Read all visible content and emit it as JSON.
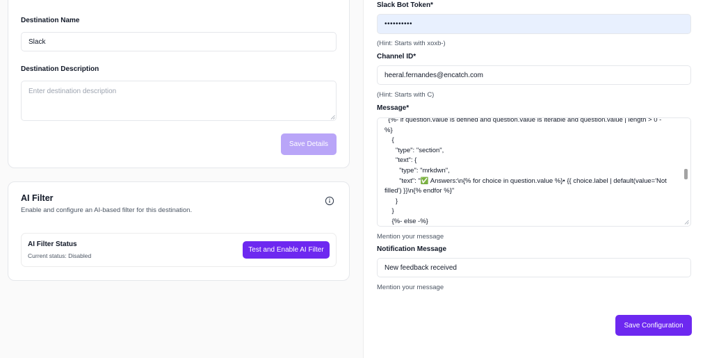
{
  "left": {
    "destination_name": {
      "label": "Destination Name",
      "value": "Slack"
    },
    "destination_description": {
      "label": "Destination Description",
      "placeholder": "Enter destination description"
    },
    "save_details_label": "Save Details",
    "ai_filter": {
      "title": "AI Filter",
      "subtitle": "Enable and configure an AI-based filter for this destination.",
      "info_icon": "info-icon",
      "status_title": "AI Filter Status",
      "status_text": "Current status: Disabled",
      "button_label": "Test and Enable AI Filter"
    }
  },
  "right": {
    "bot_token": {
      "label": "Slack Bot Token*",
      "value": "••••••••••",
      "hint": "(Hint: Starts with xoxb-)"
    },
    "channel_id": {
      "label": "Channel ID*",
      "value": "heeral.fernandes@encatch.com",
      "hint": "(Hint: Starts with C)"
    },
    "message": {
      "label": "Message*",
      "lines": [
        "  {%- if question.value is defined and question.value is iterable and question.value | length > 0 -",
        "%}",
        "    {",
        "      \"type\": \"section\",",
        "      \"text\": {",
        "        \"type\": \"mrkdwn\",",
        "        \"text\": \"✅ Answers:\\n{% for choice in question.value %}• {{ choice.label | default(value='Not",
        "filled') }}\\n{% endfor %}\"",
        "      }",
        "    }",
        "    {%- else -%}",
        "    {"
      ],
      "hint": "Mention your message"
    },
    "notification_message": {
      "label": "Notification Message",
      "value": "New feedback received",
      "hint": "Mention your message"
    },
    "save_configuration_label": "Save Configuration"
  },
  "colors": {
    "primary": "#6d28f0",
    "primary_disabled": "#b9a5f8",
    "autofill_bg": "#e8f0fe"
  }
}
